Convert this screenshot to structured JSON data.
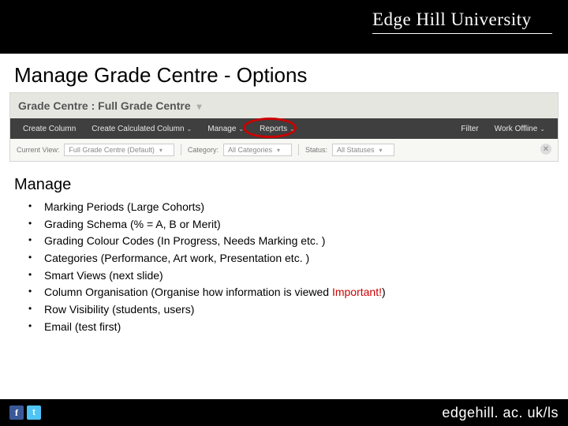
{
  "header": {
    "university": "Edge Hill University"
  },
  "title": "Manage Grade Centre - Options",
  "gradeCentre": {
    "heading": "Grade Centre : Full Grade Centre",
    "menu": {
      "createColumn": "Create Column",
      "createCalculated": "Create Calculated Column",
      "manage": "Manage",
      "reports": "Reports",
      "filter": "Filter",
      "workOffline": "Work Offline"
    },
    "filterRow": {
      "currentViewLabel": "Current View:",
      "currentView": "Full Grade Centre (Default)",
      "categoryLabel": "Category:",
      "category": "All Categories",
      "statusLabel": "Status:",
      "status": "All Statuses"
    }
  },
  "sectionTitle": "Manage",
  "bullets": [
    {
      "text": "Marking Periods (Large Cohorts)"
    },
    {
      "text": "Grading Schema (% = A, B or Merit)"
    },
    {
      "text": "Grading Colour Codes (In Progress, Needs Marking etc. )"
    },
    {
      "text": "Categories (Performance, Art work, Presentation etc. )"
    },
    {
      "text": "Smart Views (next slide)"
    },
    {
      "text": "Column Organisation (Organise how information is viewed ",
      "highlight": "Important!",
      "tail": ")"
    },
    {
      "text": "Row Visibility (students, users)"
    },
    {
      "text": "Email (test first)"
    }
  ],
  "footer": {
    "url": "edgehill. ac. uk/ls"
  },
  "icons": {
    "fb": "f",
    "tw": "t"
  }
}
